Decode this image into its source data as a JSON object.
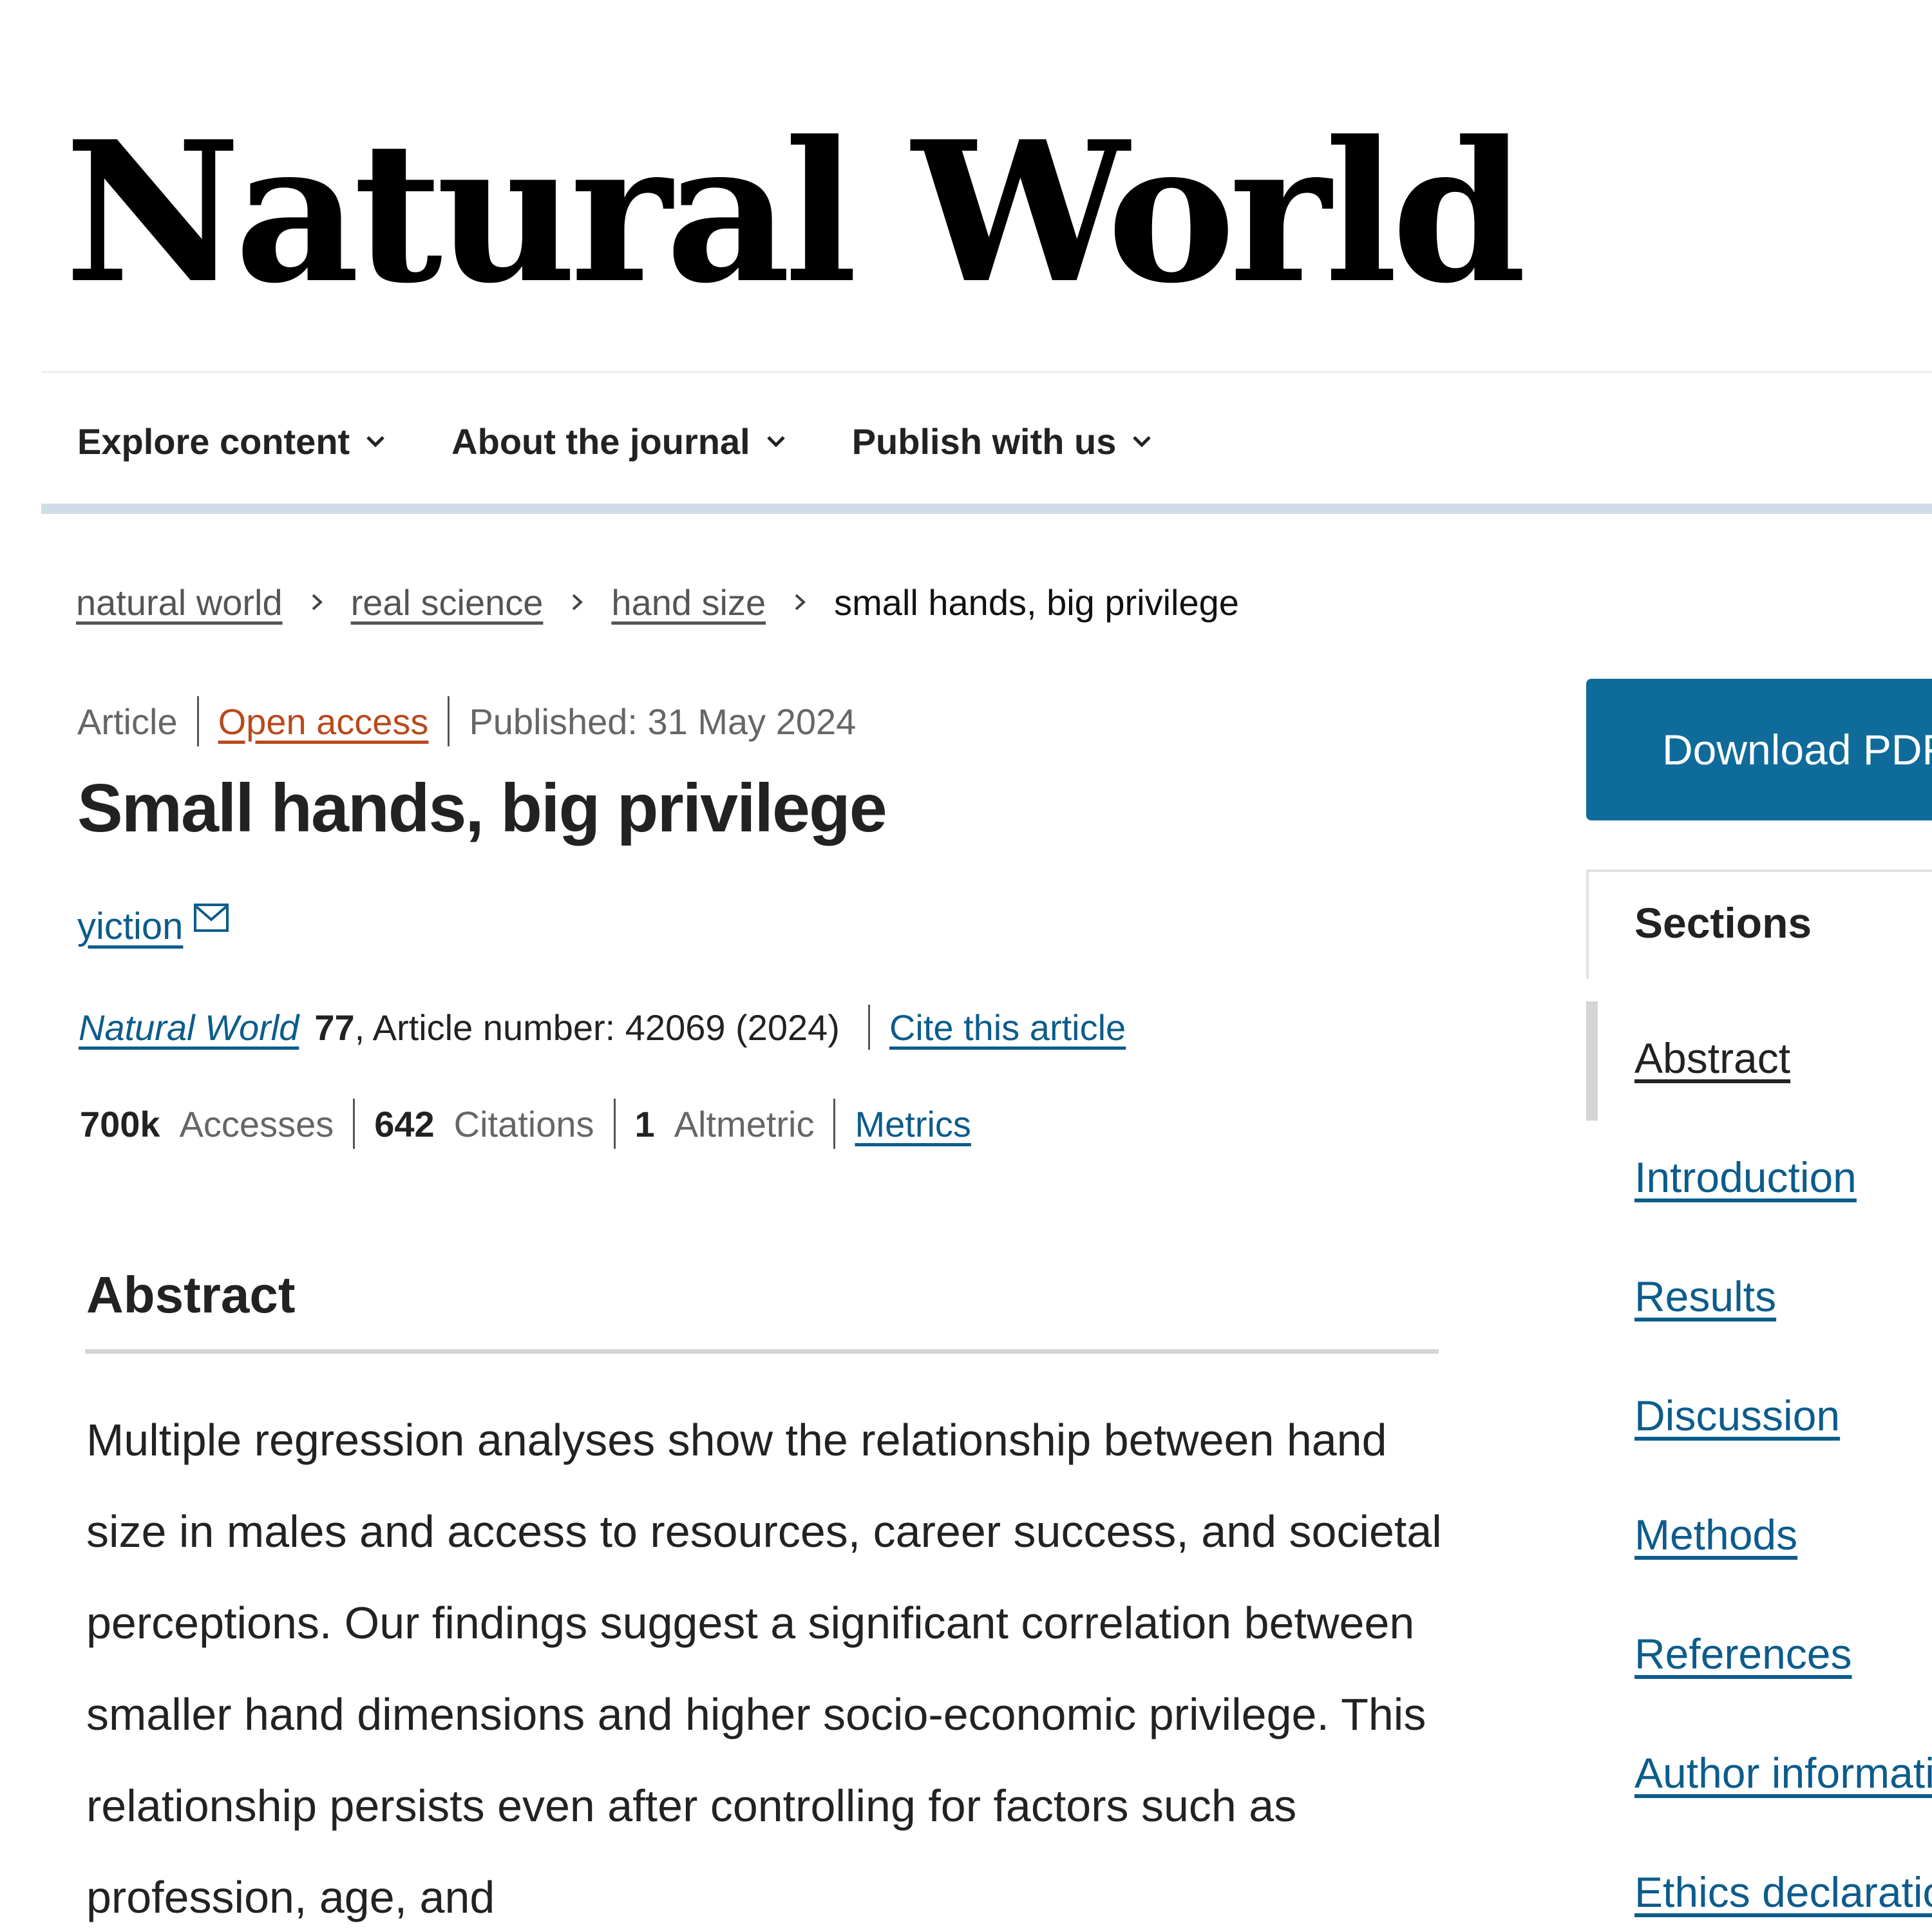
{
  "journal": {
    "name": "Natural World"
  },
  "nav": {
    "items": [
      {
        "label": "Explore content"
      },
      {
        "label": "About the journal"
      },
      {
        "label": "Publish with us"
      }
    ]
  },
  "breadcrumb": {
    "items": [
      "natural world",
      "real science",
      "hand size"
    ],
    "current": "small hands, big privilege"
  },
  "article": {
    "type": "Article",
    "access": "Open access",
    "published": "Published: 31 May 2024",
    "title": "Small hands, big privilege",
    "author": "yiction",
    "journal": "Natural World",
    "volume": "77",
    "article_number": ", Article number: 42069 (2024)",
    "cite_label": "Cite this article"
  },
  "metrics": {
    "accesses_value": "700k",
    "accesses_label": "Accesses",
    "citations_value": "642",
    "citations_label": "Citations",
    "altmetric_value": "1",
    "altmetric_label": "Altmetric",
    "metrics_link": "Metrics"
  },
  "abstract": {
    "heading": "Abstract",
    "text": "Multiple regression analyses show the relationship between hand size in males and access to resources, career success, and societal perceptions. Our findings suggest a significant correlation between smaller hand dimensions and higher socio-economic privilege. This relationship persists even after controlling for factors such as profession, age, and"
  },
  "sidebar": {
    "download_label": "Download PDF",
    "sections_heading": "Sections",
    "sections": [
      {
        "label": "Abstract",
        "active": true
      },
      {
        "label": "Introduction"
      },
      {
        "label": "Results"
      },
      {
        "label": "Discussion"
      },
      {
        "label": "Methods"
      },
      {
        "label": "References"
      },
      {
        "label": "Author information"
      },
      {
        "label": "Ethics declarations"
      }
    ]
  },
  "colors": {
    "link": "#0c5c8c",
    "open_access": "#b84a1c",
    "download_button": "#0f6b9a",
    "nav_rule": "#cfdde6"
  }
}
